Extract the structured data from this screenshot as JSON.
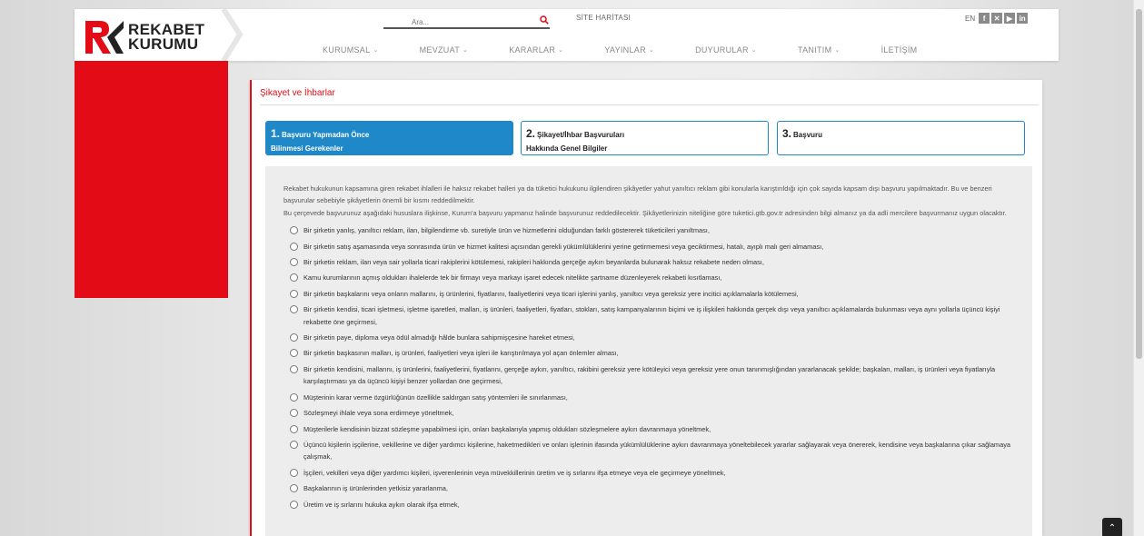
{
  "brand": {
    "line1": "REKABET",
    "line2": "KURUMU",
    "red": "#e20b16"
  },
  "search": {
    "placeholder": "Ara...",
    "icon": "search-icon"
  },
  "sitemap": "SİTE HARİTASI",
  "lang": "EN",
  "social": [
    "facebook-icon",
    "x-icon",
    "youtube-icon",
    "linkedin-icon"
  ],
  "nav": [
    {
      "label": "KURUMSAL",
      "caret": true
    },
    {
      "label": "MEVZUAT",
      "caret": true
    },
    {
      "label": "KARARLAR",
      "caret": true
    },
    {
      "label": "YAYINLAR",
      "caret": true
    },
    {
      "label": "DUYURULAR",
      "caret": true
    },
    {
      "label": "TANITIM",
      "caret": true
    },
    {
      "label": "İLETİŞİM",
      "caret": false
    }
  ],
  "page_title": "Şikayet ve İhbarlar",
  "steps": [
    {
      "num": "1.",
      "line1": "Başvuru Yapmadan Önce",
      "line2": "Bilinmesi Gerekenler",
      "active": true
    },
    {
      "num": "2.",
      "line1": "Şikayet/İhbar Başvuruları",
      "line2": "Hakkında Genel Bilgiler",
      "active": false
    },
    {
      "num": "3.",
      "line1": "Başvuru",
      "line2": "",
      "active": false
    }
  ],
  "intro": [
    "Rekabet hukukunun kapsamına giren rekabet ihlalleri ile haksız rekabet halleri ya da tüketici hukukunu ilgilendiren şikâyetler yahut yanıltıcı reklam gibi konularla karıştırıldığı için çok sayıda kapsam dışı başvuru yapılmaktadır. Bu ve benzeri başvurular sebebiyle şikâyetlerin önemli bir kısmı reddedilmektir.",
    "Bu çerçevede başvurunuz aşağıdaki hususlara ilişkinse, Kurum'a başvuru yapmanız halinde başvurunuz reddedilecektir. Şikâyetlerinizin niteliğine göre tuketici.gtb.gov.tr adresinden bilgi almanız ya da adli mercilere başvurmanız uygun olacaktır."
  ],
  "items": [
    "Bir şirketin yanlış, yanıltıcı reklam, ilan, bilgilendirme vb. suretiyle ürün ve hizmetlerini olduğundan farklı göstererek tüketicileri yanıltması,",
    "Bir şirketin satış aşamasında veya sonrasında ürün ve hizmet kalitesi açısından gerekli yükümlülüklerini yerine getirmemesi veya geciktirmesi, hatalı, ayıplı malı geri almaması,",
    "Bir şirketin reklam, ilan veya sair yollarla ticari rakiplerini kötülemesi, rakipleri hakkında gerçeğe aykırı beyanlarda bulunarak haksız rekabete neden olması,",
    "Kamu kurumlarının açmış oldukları ihalelerde tek bir firmayı veya markayı işaret edecek nitelikte şartname düzenleyerek rekabeti kısıtlaması,",
    "Bir şirketin başkalarını veya onların mallarını, iş ürünlerini, fiyatlarını, faaliyetlerini veya ticari işlerini yanlış, yanıltıcı veya gereksiz yere incitici açıklamalarla kötülemesi,",
    "Bir şirketin kendisi, ticari işletmesi, işletme işaretleri, malları, iş ürünleri, faaliyetleri, fiyatları, stokları, satış kampanyalarının biçimi ve iş ilişkileri hakkında gerçek dışı veya yanıltıcı açıklamalarda bulunması veya aynı yollarla üçüncü kişiyi rekabette öne geçirmesi,",
    "Bir şirketin paye, diploma veya ödül almadığı hâlde bunlara sahipmişçesine hareket etmesi,",
    "Bir şirketin başkasının malları, iş ürünleri, faaliyetleri veya işleri ile karıştırılmaya yol açan önlemler alması,",
    "Bir şirketin kendisini, mallarını, iş ürünlerini, faaliyetlerini, fiyatlarını, gerçeğe aykırı, yanıltıcı, rakibini gereksiz yere kötüleyici veya gereksiz yere onun tanınmışlığından yararlanacak şekilde; başkaları, malları, iş ürünleri veya fiyatlarıyla karşılaştırması ya da üçüncü kişiyi benzer yollardan öne geçirmesi,",
    "Müşterinin karar verme özgürlüğünün özellikle saldırgan satış yöntemleri ile sınırlanması,",
    "Sözleşmeyi ihlale veya sona erdirmeye yöneltmek,",
    "Müşterilerle kendisinin bizzat sözleşme yapabilmesi için, onları başkalarıyla yapmış oldukları sözleşmelere aykırı davranmaya yöneltmek,",
    "Üçüncü kişilerin işçilerine, vekillerine ve diğer yardımcı kişilerine, haketmedikleri ve onları işlerinin ifasında yükümlülüklerine aykırı davranmaya yöneltebilecek yararlar sağlayarak veya önererek, kendisine veya başkalarına çıkar sağlamaya çalışmak,",
    "İşçileri, vekilleri veya diğer yardımcı kişileri, işverenlerinin veya müvekkillerinin üretim ve iş sırlarını ifşa etmeye veya ele geçirmeye yöneltmek,",
    "Başkalarının iş ürünlerinden yetkisiz yararlanma,",
    "Üretim ve iş sırlarını hukuka aykırı olarak ifşa etmek,"
  ],
  "scroll_top_icon": "arrow-up-icon"
}
